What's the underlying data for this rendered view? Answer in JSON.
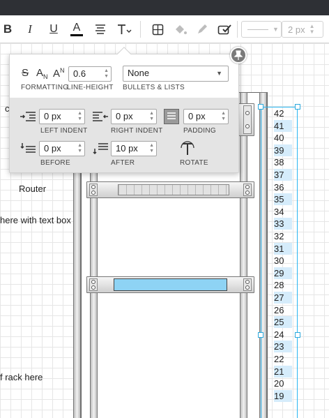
{
  "toolbar": {
    "bold_label": "B",
    "italic_label": "I",
    "underline_label": "U",
    "font_color_label": "A",
    "font_color_accent": "#000000",
    "line_width_value": "2 px"
  },
  "canvas": {
    "labels": [
      "c",
      "Router",
      "here with text box",
      "f rack here"
    ]
  },
  "rack": {
    "panel_color": "#8ed3f4",
    "selection_color": "#29b6f2",
    "unit_numbers": [
      "42",
      "41",
      "40",
      "39",
      "38",
      "37",
      "36",
      "35",
      "34",
      "33",
      "32",
      "31",
      "30",
      "29",
      "28",
      "27",
      "26",
      "25",
      "24",
      "23",
      "22",
      "21",
      "20",
      "19"
    ]
  },
  "text_popup": {
    "formatting_label": "FORMATTING",
    "line_height_label": "LINE-HEIGHT",
    "line_height_value": "0.6",
    "bullets_label": "BULLETS & LISTS",
    "bullets_value": "None",
    "left_indent_label": "LEFT INDENT",
    "left_indent_value": "0 px",
    "right_indent_label": "RIGHT INDENT",
    "right_indent_value": "0 px",
    "padding_label": "PADDING",
    "padding_value": "0 px",
    "before_label": "BEFORE",
    "before_value": "0 px",
    "after_label": "AFTER",
    "after_value": "10 px",
    "rotate_label": "ROTATE"
  }
}
